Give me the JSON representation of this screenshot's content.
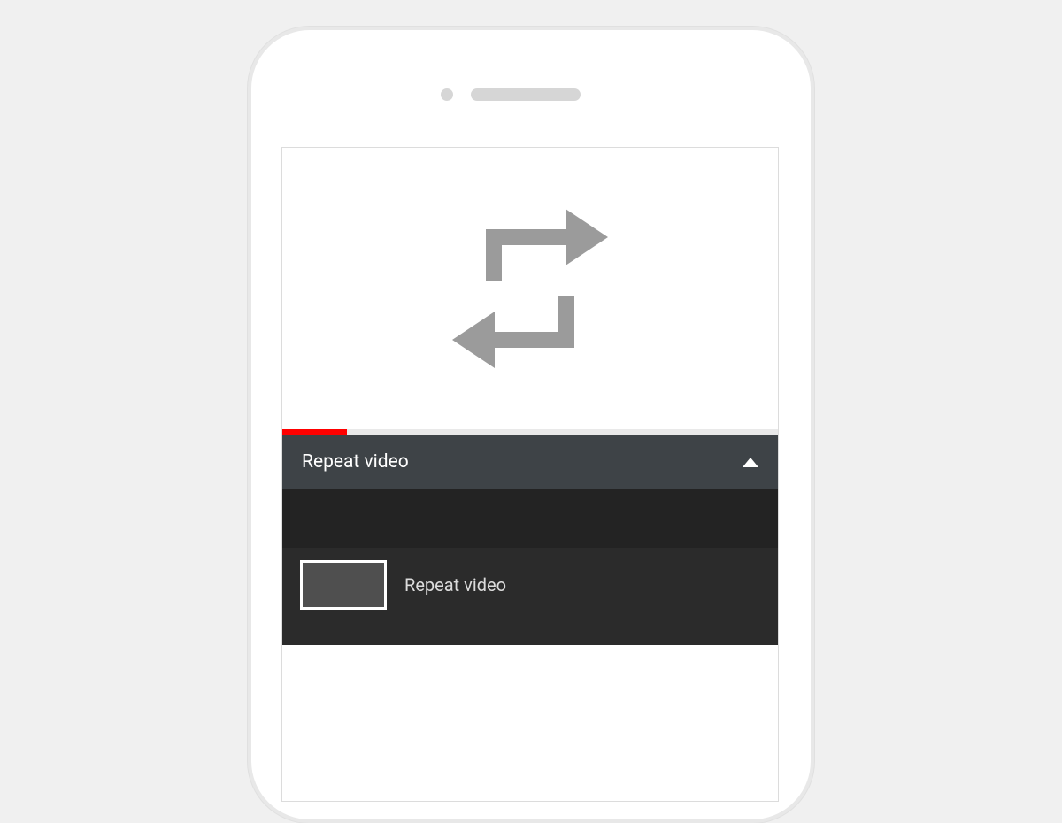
{
  "header": {
    "title": "Repeat video"
  },
  "list": {
    "items": [
      {
        "label": "Repeat video"
      }
    ]
  },
  "progress": {
    "percent": 13
  },
  "colors": {
    "accent": "#ff0000",
    "headerBg": "#3e4347",
    "darkBg": "#232323",
    "listBg": "#2b2b2b"
  }
}
